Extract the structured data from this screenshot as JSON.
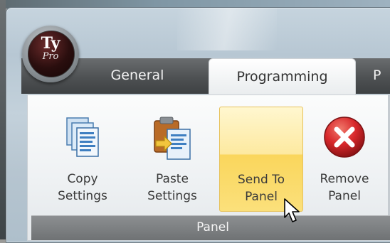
{
  "app": {
    "logo_line1": "Ty",
    "logo_line2": "Pro"
  },
  "tabs": [
    {
      "label": "General",
      "active": false
    },
    {
      "label": "Programming",
      "active": true
    },
    {
      "label": "P",
      "active": false
    }
  ],
  "ribbon": {
    "group_label": "Panel",
    "buttons": [
      {
        "line1": "Copy",
        "line2": "Settings",
        "icon": "copy-settings-icon"
      },
      {
        "line1": "Paste",
        "line2": "Settings",
        "icon": "paste-settings-icon"
      },
      {
        "line1": "Send To",
        "line2": "Panel",
        "icon": "",
        "hovered": true
      },
      {
        "line1": "Remove",
        "line2": "Panel",
        "icon": "remove-icon"
      }
    ]
  },
  "colors": {
    "hover_fill": "#fad65c",
    "remove_red": "#d8282b",
    "tabstrip": "#4e5153"
  }
}
